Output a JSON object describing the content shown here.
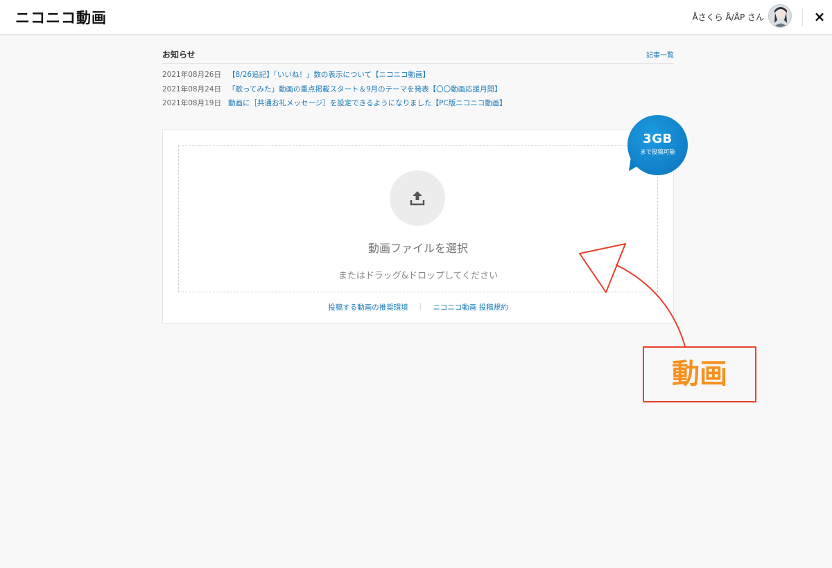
{
  "header": {
    "logo": "ニコニコ動画",
    "user_name": "Åさくら Å/ÅP さん",
    "close": "×"
  },
  "news": {
    "title": "お知らせ",
    "all_link": "記事一覧",
    "items": [
      {
        "date": "2021年08月26日",
        "text": "【8/26追記】「いいね！」数の表示について【ニコニコ動画】"
      },
      {
        "date": "2021年08月24日",
        "text": "「歌ってみた」動画の重点掲載スタート＆9月のテーマを発表【〇〇動画応援月間】"
      },
      {
        "date": "2021年08月19日",
        "text": "動画に［共通お礼メッセージ］を設定できるようになりました【PC版ニコニコ動画】"
      }
    ]
  },
  "upload": {
    "select_label": "動画ファイルを選択",
    "drag_label": "またはドラッグ&ドロップしてください",
    "links": [
      "投稿する動画の推奨環境",
      "ニコニコ動画 投稿規約"
    ]
  },
  "badge": {
    "main": "3GB",
    "sub": "まで投稿可能"
  },
  "annotation": {
    "text": "動画"
  },
  "colors": {
    "link": "#1a7ab8",
    "badge": "#0b73bd",
    "annotation_red": "#e8412c",
    "annotation_orange": "#f7901e"
  }
}
